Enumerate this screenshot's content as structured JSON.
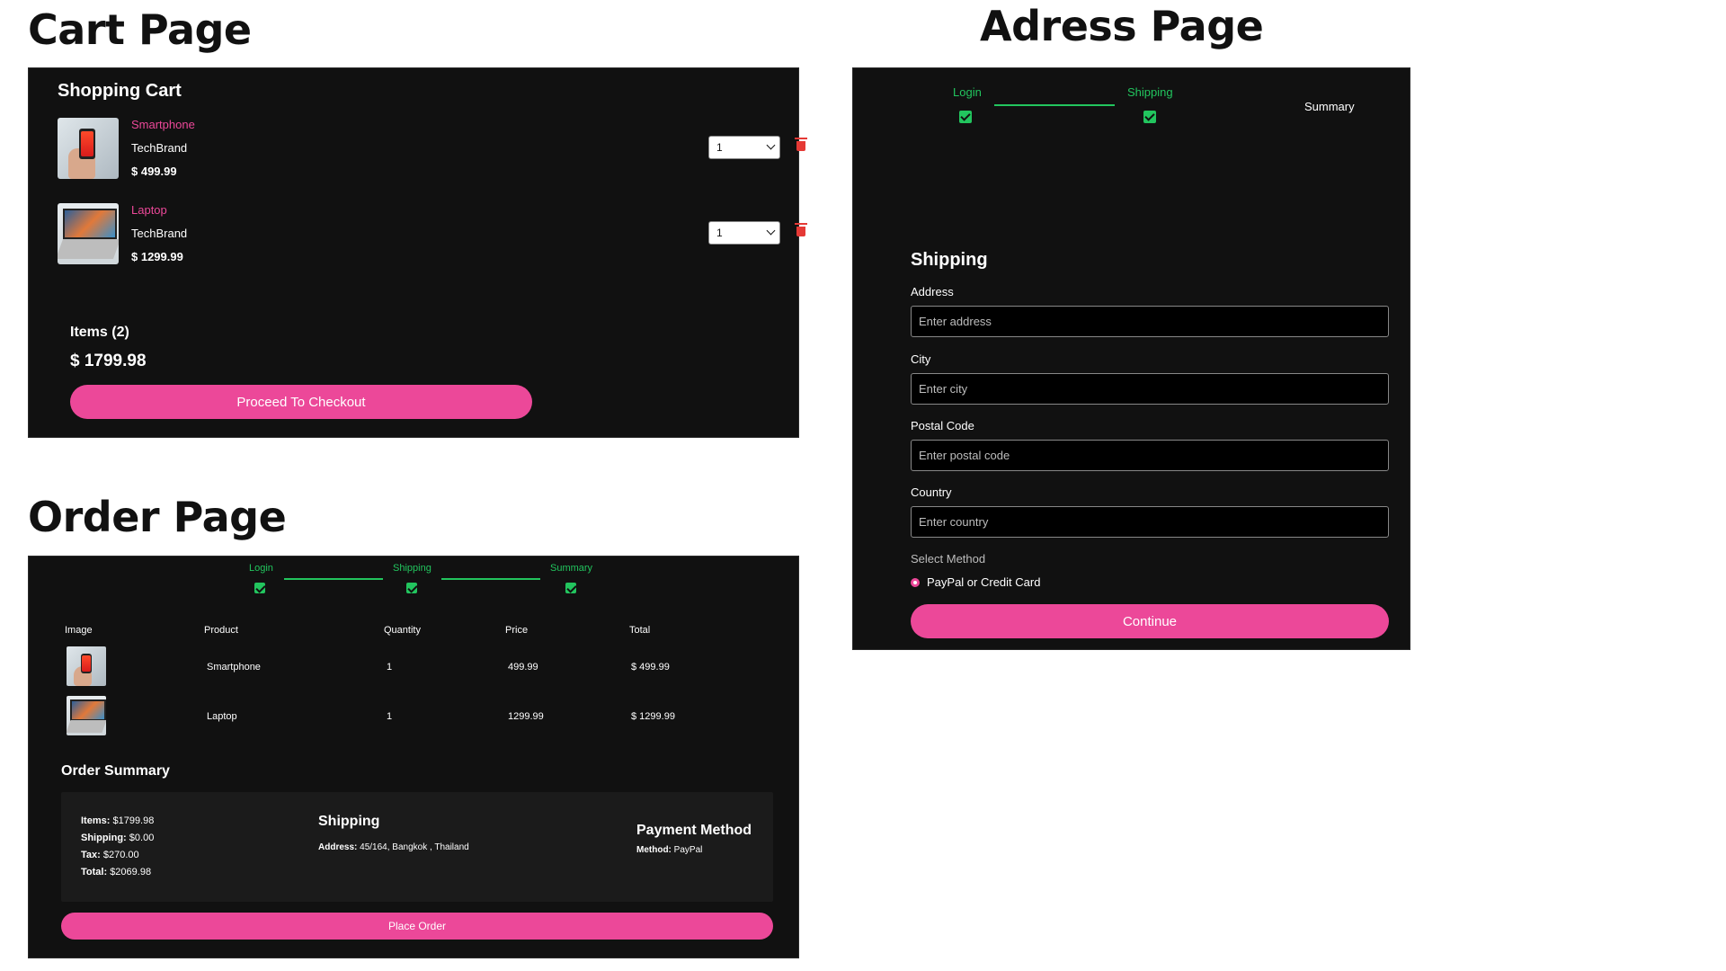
{
  "titles": {
    "cart": "Cart Page",
    "address": "Adress Page",
    "order": "Order Page"
  },
  "cart": {
    "heading": "Shopping Cart",
    "items": [
      {
        "name": "Smartphone",
        "brand": "TechBrand",
        "price": "$ 499.99",
        "qty": "1"
      },
      {
        "name": "Laptop",
        "brand": "TechBrand",
        "price": "$ 1299.99",
        "qty": "1"
      }
    ],
    "items_count": "Items (2)",
    "total": "$ 1799.98",
    "checkout_label": "Proceed To Checkout"
  },
  "address": {
    "steps": {
      "login": "Login",
      "shipping": "Shipping",
      "summary": "Summary"
    },
    "heading": "Shipping",
    "fields": [
      {
        "label": "Address",
        "placeholder": "Enter address"
      },
      {
        "label": "City",
        "placeholder": "Enter city"
      },
      {
        "label": "Postal Code",
        "placeholder": "Enter postal code"
      },
      {
        "label": "Country",
        "placeholder": "Enter country"
      }
    ],
    "select_method": "Select Method",
    "payment_option": "PayPal or Credit Card",
    "continue_label": "Continue"
  },
  "order": {
    "steps": {
      "login": "Login",
      "shipping": "Shipping",
      "summary": "Summary"
    },
    "columns": [
      "Image",
      "Product",
      "Quantity",
      "Price",
      "Total"
    ],
    "rows": [
      {
        "product": "Smartphone",
        "quantity": "1",
        "price": "499.99",
        "total": "$ 499.99"
      },
      {
        "product": "Laptop",
        "quantity": "1",
        "price": "1299.99",
        "total": "$ 1299.99"
      }
    ],
    "summary_heading": "Order Summary",
    "summary": {
      "items_label": "Items:",
      "items_value": "$1799.98",
      "shipping_label": "Shipping:",
      "shipping_value": "$0.00",
      "tax_label": "Tax:",
      "tax_value": "$270.00",
      "total_label": "Total:",
      "total_value": "$2069.98"
    },
    "shipping_title": "Shipping",
    "address_label": "Address:",
    "address_value": "45/164, Bangkok , Thailand",
    "payment_title": "Payment Method",
    "method_label": "Method:",
    "method_value": "PayPal",
    "place_order_label": "Place Order"
  },
  "colors": {
    "accent": "#ec4899",
    "success": "#22c55e",
    "panel": "#111111",
    "danger": "#e53935"
  },
  "icons": [
    "trash-icon",
    "check-icon",
    "chevron-down-icon",
    "radio-icon"
  ]
}
